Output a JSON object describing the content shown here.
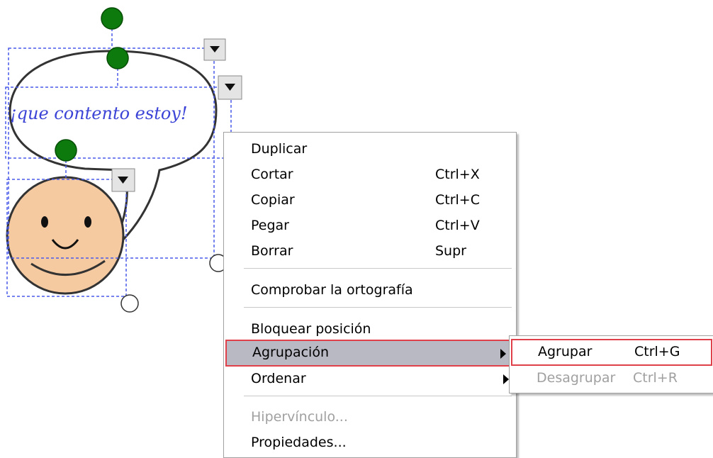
{
  "canvas": {
    "bubble_text": "¡que contento estoy!"
  },
  "context_menu": {
    "items": [
      {
        "label": "Duplicar",
        "shortcut": ""
      },
      {
        "label": "Cortar",
        "shortcut": "Ctrl+X"
      },
      {
        "label": "Copiar",
        "shortcut": "Ctrl+C"
      },
      {
        "label": "Pegar",
        "shortcut": "Ctrl+V"
      },
      {
        "label": "Borrar",
        "shortcut": "Supr"
      },
      {
        "label": "Comprobar la ortografía",
        "shortcut": ""
      },
      {
        "label": "Bloquear posición",
        "shortcut": ""
      },
      {
        "label": "Agrupación",
        "shortcut": ""
      },
      {
        "label": "Ordenar",
        "shortcut": ""
      },
      {
        "label": "Hipervínculo...",
        "shortcut": ""
      },
      {
        "label": "Propiedades...",
        "shortcut": ""
      }
    ]
  },
  "submenu": {
    "items": [
      {
        "label": "Agrupar",
        "shortcut": "Ctrl+G"
      },
      {
        "label": "Desagrupar",
        "shortcut": "Ctrl+R"
      }
    ]
  },
  "colors": {
    "handle_green": "#0d7a0d",
    "selection_blue": "#4a5ae8",
    "face_fill": "#f6caa0",
    "text_blue": "#3b44d6",
    "highlight": "#b9b9c4",
    "highlight_border": "#e0404a"
  }
}
